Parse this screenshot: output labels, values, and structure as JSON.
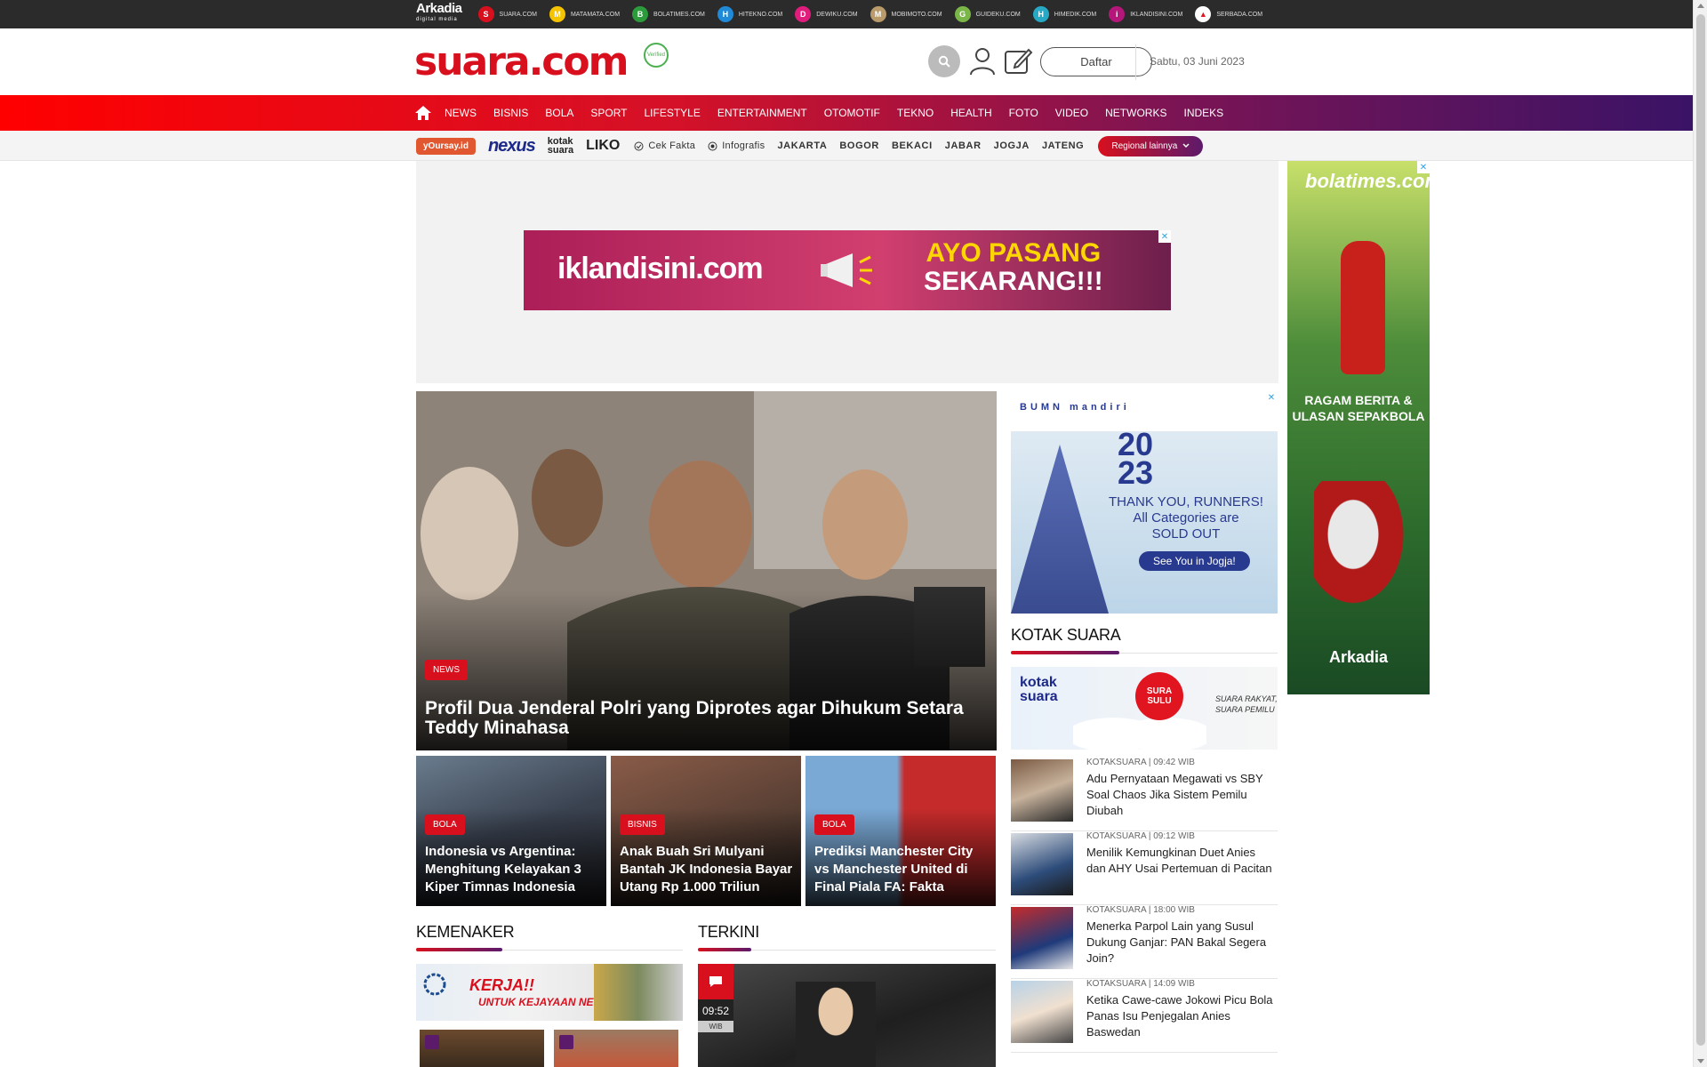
{
  "network_bar": {
    "brand": "Arkadia",
    "brand_sub": "digital media",
    "sites": [
      {
        "label": "SUARA.COM",
        "icon": "suara-icon",
        "color": "#d8101e",
        "glyph": "S"
      },
      {
        "label": "MATAMATA.COM",
        "icon": "matamata-icon",
        "color": "#f5c400",
        "glyph": "M"
      },
      {
        "label": "BOLATIMES.COM",
        "icon": "bolatimes-icon",
        "color": "#2b9b3c",
        "glyph": "B"
      },
      {
        "label": "HITEKNO.COM",
        "icon": "hitekno-icon",
        "color": "#1f8ad8",
        "glyph": "H"
      },
      {
        "label": "DEWIKU.COM",
        "icon": "dewiku-icon",
        "color": "#e01d7c",
        "glyph": "D"
      },
      {
        "label": "MOBIMOTO.COM",
        "icon": "mobimoto-icon",
        "color": "#b99a6b",
        "glyph": "M"
      },
      {
        "label": "GUIDEKU.COM",
        "icon": "guideku-icon",
        "color": "#7ab648",
        "glyph": "G"
      },
      {
        "label": "HIMEDIK.COM",
        "icon": "himedik-icon",
        "color": "#27a9c6",
        "glyph": "H"
      },
      {
        "label": "IKLANDISINI.COM",
        "icon": "iklandisini-icon",
        "color": "#b5167a",
        "glyph": "i"
      },
      {
        "label": "SERBADA.COM",
        "icon": "serbada-icon",
        "color": "#ffffff",
        "glyph": "▲"
      }
    ]
  },
  "header": {
    "logo_text": "suara.com",
    "badge_text": "Verified",
    "register_label": "Daftar",
    "date": "Sabtu, 03 Juni 2023"
  },
  "main_nav": {
    "items": [
      "NEWS",
      "BISNIS",
      "BOLA",
      "SPORT",
      "LIFESTYLE",
      "ENTERTAINMENT",
      "OTOMOTIF",
      "TEKNO",
      "HEALTH",
      "FOTO",
      "VIDEO",
      "NETWORKS",
      "INDEKS"
    ]
  },
  "sub_nav": {
    "yoursay": "yOursay.id",
    "nexus": "nexus",
    "kotaksuara_line1": "kotak",
    "kotaksuara_line2": "suara",
    "liko": "LIKO",
    "cek_fakta": "Cek Fakta",
    "infografis": "Infografis",
    "regions": [
      "JAKARTA",
      "BOGOR",
      "BEKACI",
      "JABAR",
      "JOGJA",
      "JATENG"
    ],
    "regional_more": "Regional lainnya"
  },
  "ads": {
    "top_brand": "iklandisini.com",
    "top_cta_1": "AYO PASANG",
    "top_cta_2": "SEKARANG!!!",
    "close_glyph": "✕",
    "sky_brand": "bolatimes.com",
    "sky_line1": "RAGAM BERITA &",
    "sky_line2": "ULASAN SEPAKBOLA",
    "sky_footer": "Arkadia",
    "side_logos": "BUMN mandiri",
    "side_year_1": "20",
    "side_year_2": "23",
    "side_msg_1": "THANK YOU, RUNNERS!",
    "side_msg_2": "All Categories are",
    "side_msg_3": "SOLD OUT",
    "side_pill": "See You in Jogja!"
  },
  "hero": {
    "badge": "NEWS",
    "title": "Profil Dua Jenderal Polri yang Diprotes agar Dihukum Setara Teddy Minahasa"
  },
  "cards": [
    {
      "badge": "BOLA",
      "title": "Indonesia vs Argentina: Menghitung Kelayakan 3 Kiper Timnas Indonesia Bertarung Lawan Messi"
    },
    {
      "badge": "BISNIS",
      "title": "Anak Buah Sri Mulyani Bantah JK Indonesia Bayar Utang Rp 1.000 Triliun"
    },
    {
      "badge": "BOLA",
      "title": "Prediksi Manchester City vs Manchester United di Final Piala FA: Fakta Menarik"
    }
  ],
  "sections": {
    "kemenaker": "KEMENAKER",
    "kemenaker_banner_1": "KERJA!!",
    "kemenaker_banner_2": "UNTUK KEJAYAAN NEGERI",
    "terkini": "TERKINI",
    "terkini_time": "09:52",
    "terkini_tz": "WIB",
    "kotak_suara": "KOTAK SUARA"
  },
  "kotak_suara_banner": {
    "title_1": "kotak",
    "title_2": "suara",
    "circle": "SURA SULU",
    "tag_1": "SUARA RAKYAT,",
    "tag_2": "SUARA PEMILU"
  },
  "kotak_suara_list": [
    {
      "meta": "KOTAKSUARA | 09:42 WIB",
      "title": "Adu Pernyataan Megawati vs SBY Soal Chaos Jika Sistem Pemilu Diubah"
    },
    {
      "meta": "KOTAKSUARA | 09:12 WIB",
      "title": "Menilik Kemungkinan Duet Anies dan AHY Usai Pertemuan di Pacitan"
    },
    {
      "meta": "KOTAKSUARA | 18:00 WIB",
      "title": "Menerka Parpol Lain yang Susul Dukung Ganjar: PAN Bakal Segera Join?"
    },
    {
      "meta": "KOTAKSUARA | 14:09 WIB",
      "title": "Ketika Cawe-cawe Jokowi Picu Bola Panas Isu Penjegalan Anies Baswedan"
    }
  ]
}
